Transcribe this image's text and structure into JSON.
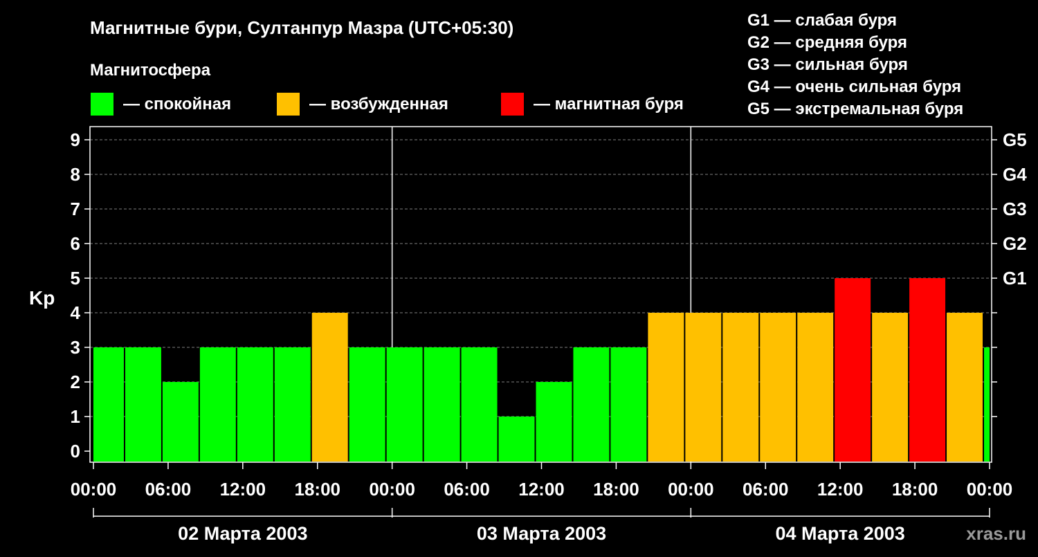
{
  "chart_data": {
    "type": "bar",
    "title": "Магнитные бури, Султанпур Мазра (UTC+05:30)",
    "subtitle": "Магнитосфера",
    "ylabel": "Kp",
    "ylim": [
      0,
      9
    ],
    "yticks": [
      "0",
      "1",
      "2",
      "3",
      "4",
      "5",
      "6",
      "7",
      "8",
      "9"
    ],
    "right_ticks": [
      {
        "kp": 5,
        "label": "G1"
      },
      {
        "kp": 6,
        "label": "G2"
      },
      {
        "kp": 7,
        "label": "G3"
      },
      {
        "kp": 8,
        "label": "G4"
      },
      {
        "kp": 9,
        "label": "G5"
      }
    ],
    "xticks": [
      "00:00",
      "06:00",
      "12:00",
      "18:00",
      "00:00",
      "06:00",
      "12:00",
      "18:00",
      "00:00",
      "06:00",
      "12:00",
      "18:00",
      "00:00"
    ],
    "days": [
      "02 Марта 2003",
      "03 Марта 2003",
      "04 Марта 2003"
    ],
    "legend": [
      {
        "label": "— спокойная",
        "color": "#00ff00"
      },
      {
        "label": "— возбужденная",
        "color": "#ffc000"
      },
      {
        "label": "— магнитная буря",
        "color": "#ff0000"
      }
    ],
    "scale_legend": [
      "G1 — слабая буря",
      "G2 — средняя буря",
      "G3 — сильная буря",
      "G4 — очень сильная буря",
      "G5 — экстремальная буря"
    ],
    "grid": true,
    "x_hours_total": 72,
    "x_offset_hours": 5.5,
    "interval_hours": 3,
    "values": [
      3,
      3,
      2,
      3,
      3,
      3,
      4,
      3,
      3,
      3,
      3,
      1,
      2,
      3,
      3,
      4,
      4,
      4,
      4,
      4,
      5,
      4,
      5,
      4,
      3
    ],
    "colors": {
      "quiet": "#00ff00",
      "active": "#ffc000",
      "storm": "#ff0000"
    }
  },
  "watermark": "xras.ru"
}
